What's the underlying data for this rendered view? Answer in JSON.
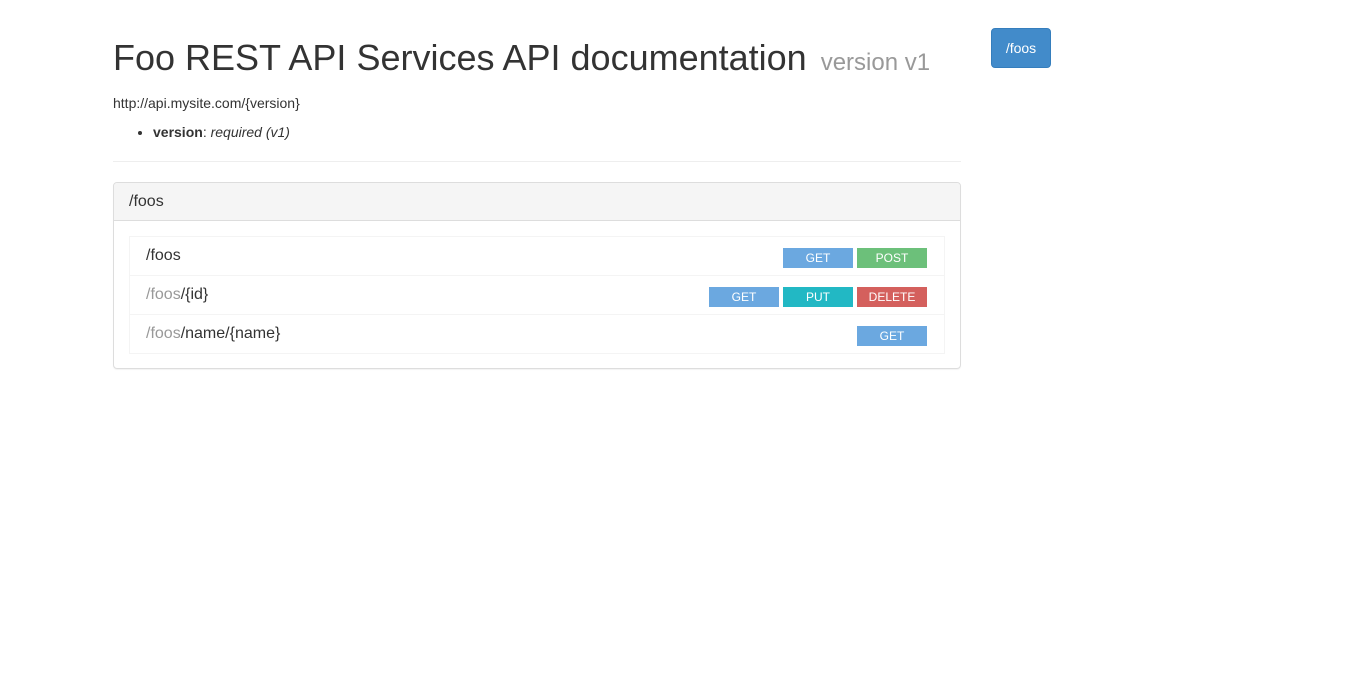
{
  "header": {
    "title": "Foo REST API Services API documentation",
    "version_label": "version v1",
    "base_uri": "http://api.mysite.com/{version}"
  },
  "base_uri_params": [
    {
      "name": "version",
      "description": "required (v1)"
    }
  ],
  "sidebar": {
    "nav_button_label": "/foos"
  },
  "resource_group": {
    "title": "/foos",
    "resources": [
      {
        "parent": "",
        "path": "/foos",
        "methods": [
          "GET",
          "POST"
        ]
      },
      {
        "parent": "/foos",
        "path": "/{id}",
        "methods": [
          "GET",
          "PUT",
          "DELETE"
        ]
      },
      {
        "parent": "/foos",
        "path": "/name/{name}",
        "methods": [
          "GET"
        ]
      }
    ]
  },
  "colors": {
    "get": "#6ba8e0",
    "post": "#6cc07a",
    "put": "#22b8c4",
    "delete": "#d4605d",
    "nav_button": "#428bca"
  }
}
